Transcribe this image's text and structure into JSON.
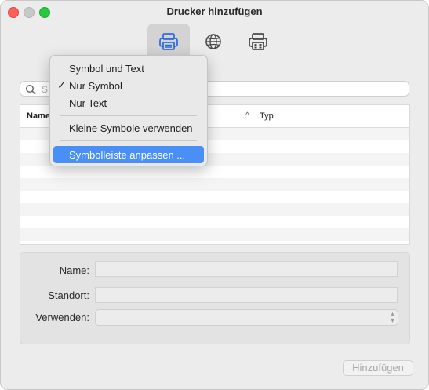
{
  "window": {
    "title": "Drucker hinzufügen"
  },
  "toolbar": {
    "items": [
      {
        "name": "printer-icon",
        "active": true
      },
      {
        "name": "globe-icon",
        "active": false
      },
      {
        "name": "fax-printer-icon",
        "active": false
      }
    ]
  },
  "search": {
    "placeholder_visible": "S"
  },
  "list": {
    "columns": [
      {
        "label": "Name"
      },
      {
        "label": "Typ"
      }
    ],
    "sort_indicator": "^"
  },
  "form": {
    "name_label": "Name:",
    "location_label": "Standort:",
    "use_label": "Verwenden:",
    "name_value": "",
    "location_value": "",
    "use_value": ""
  },
  "buttons": {
    "add_label": "Hinzufügen"
  },
  "context_menu": {
    "items": [
      {
        "label": "Symbol und Text",
        "checked": false,
        "highlighted": false
      },
      {
        "label": "Nur Symbol",
        "checked": true,
        "highlighted": false
      },
      {
        "label": "Nur Text",
        "checked": false,
        "highlighted": false
      },
      {
        "label": "Kleine Symbole verwenden",
        "checked": false,
        "highlighted": false
      },
      {
        "label": "Symbolleiste anpassen ...",
        "checked": false,
        "highlighted": true
      }
    ],
    "check_glyph": "✓"
  },
  "colors": {
    "accent": "#4a8ff5",
    "toolbar_active_icon": "#2f6fe0",
    "close": "#ff5f57",
    "maximize": "#28c840"
  }
}
